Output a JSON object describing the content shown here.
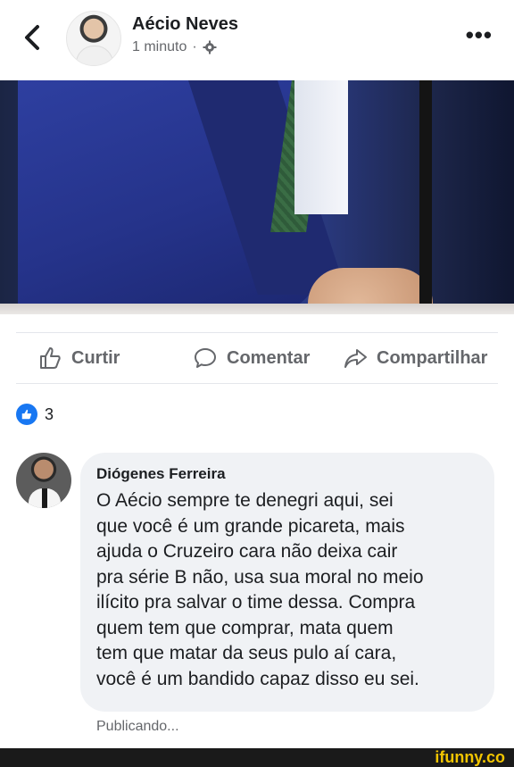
{
  "header": {
    "author": "Aécio Neves",
    "time": "1 minuto",
    "separator": "·",
    "more_label": "•••"
  },
  "actions": {
    "like": "Curtir",
    "comment": "Comentar",
    "share": "Compartilhar"
  },
  "reactions": {
    "count": "3"
  },
  "comment": {
    "author": "Diógenes Ferreira",
    "text": "O Aécio sempre te denegri  aqui, sei\nque você é um grande picareta, mais\najuda o Cruzeiro cara não deixa cair\npra série B não, usa sua moral no meio\nilícito pra salvar o time dessa. Compra\nquem tem que comprar, mata quem\ntem que matar da seus pulo aí cara,\nvocê é um bandido capaz disso eu sei.",
    "status": "Publicando..."
  },
  "watermark": {
    "text": "ifunny.co"
  },
  "colors": {
    "accent": "#1877f2",
    "muted": "#65676b",
    "bubble": "#f0f2f5",
    "brand": "#f2c500"
  },
  "icons": [
    "back-chevron-icon",
    "gear-icon",
    "thumbs-up-icon",
    "comment-icon",
    "share-icon",
    "like-badge-icon"
  ]
}
